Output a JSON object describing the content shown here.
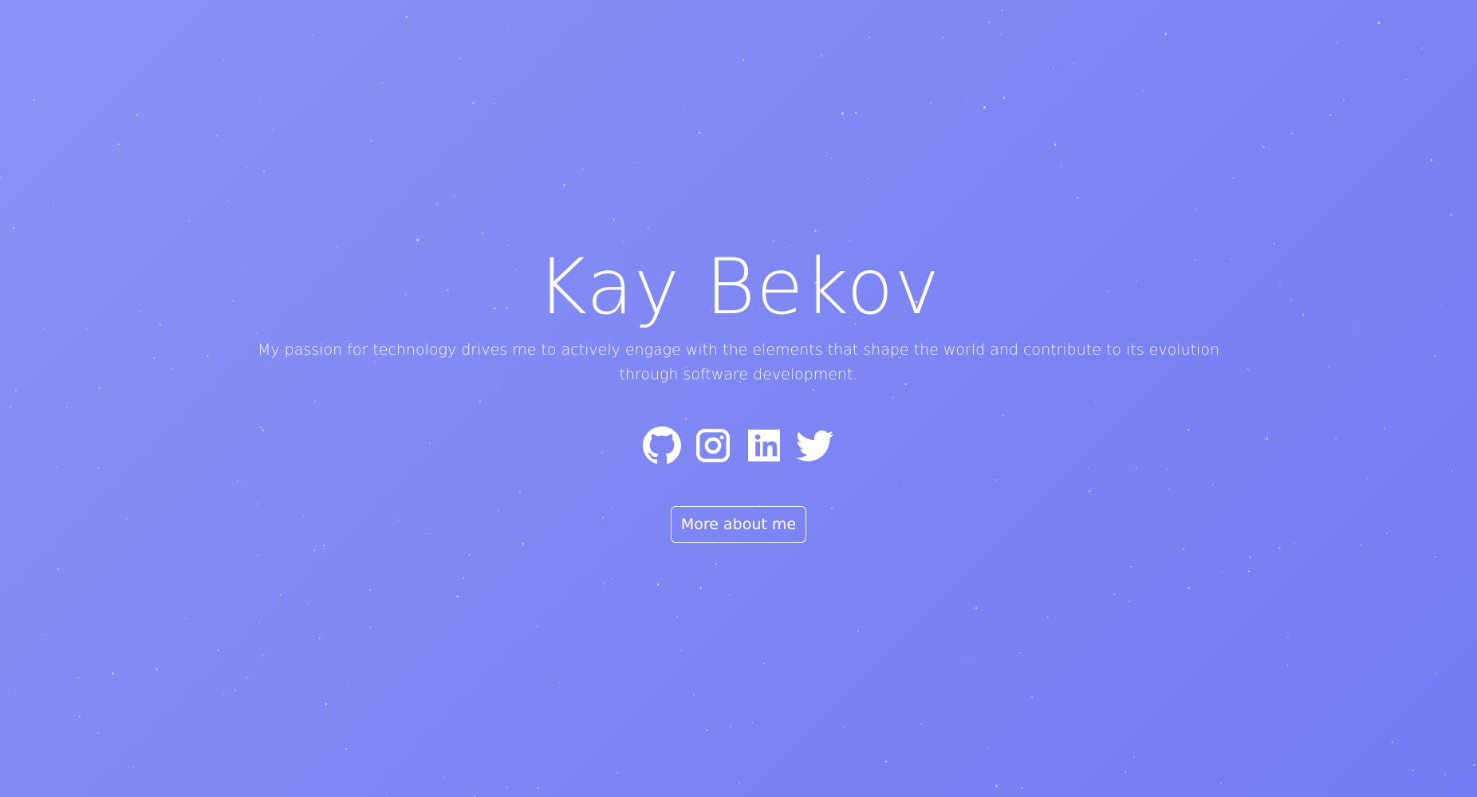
{
  "hero": {
    "name": "Kay Bekov",
    "tagline": "My passion for technology drives me to actively engage with the elements that shape the world and contribute to its evolution through software development.",
    "more_button_label": "More about me"
  },
  "socials": [
    {
      "name": "GitHub",
      "icon": "github-icon"
    },
    {
      "name": "Instagram",
      "icon": "instagram-icon"
    },
    {
      "name": "LinkedIn",
      "icon": "linkedin-icon"
    },
    {
      "name": "Twitter",
      "icon": "twitter-icon"
    }
  ],
  "colors": {
    "background_start": "#8a93f5",
    "background_end": "#737bf2",
    "text": "#ffffff"
  }
}
